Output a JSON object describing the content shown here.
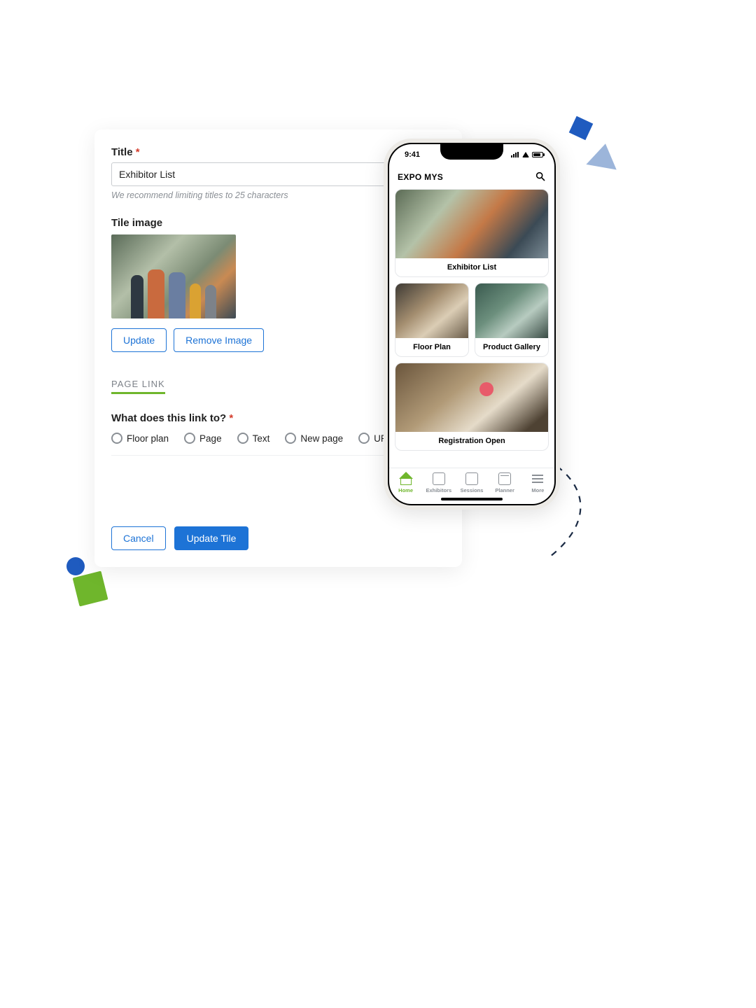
{
  "form": {
    "title_label": "Title",
    "title_value": "Exhibitor List",
    "title_helper": "We recommend limiting titles to 25 characters",
    "tile_image_label": "Tile image",
    "update_btn": "Update",
    "remove_btn": "Remove Image",
    "page_link_tab": "PAGE LINK",
    "link_question": "What does this link to?",
    "radio_options": {
      "floor_plan": "Floor plan",
      "page": "Page",
      "text": "Text",
      "new_page": "New page",
      "url": "URL"
    },
    "cancel_btn": "Cancel",
    "update_tile_btn": "Update Tile"
  },
  "phone": {
    "status_time": "9:41",
    "app_name": "EXPO MYS",
    "tiles": {
      "exhibitor_list": "Exhibitor List",
      "floor_plan": "Floor Plan",
      "product_gallery": "Product Gallery",
      "registration_open": "Registration Open"
    },
    "tabs": {
      "home": "Home",
      "exhibitors": "Exhibitors",
      "sessions": "Sessions",
      "planner": "Planner",
      "more": "More"
    }
  }
}
